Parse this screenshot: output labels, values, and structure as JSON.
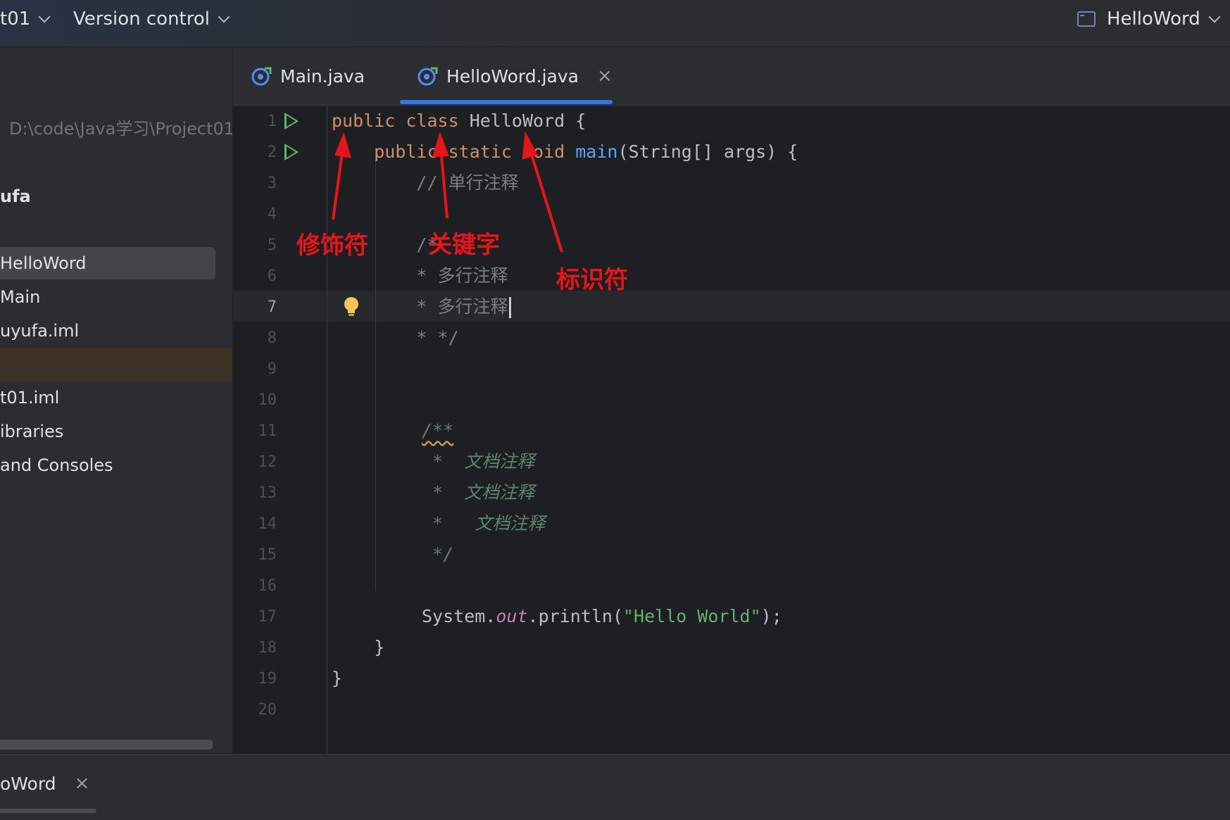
{
  "titlebar": {
    "project_label": "t01",
    "vcs_label": "Version control",
    "run_config": "HelloWord"
  },
  "sidebar": {
    "path": "D:\\code\\Java学习\\Project01",
    "module": "ufa",
    "items": [
      {
        "label": "HelloWord",
        "selected": true
      },
      {
        "label": "Main"
      },
      {
        "label": "uyufa.iml"
      },
      {
        "label": "",
        "active": true
      },
      {
        "label": "t01.iml"
      },
      {
        "label": "ibraries"
      },
      {
        "label": "and Consoles"
      }
    ]
  },
  "tabs": [
    {
      "label": "Main.java"
    },
    {
      "label": "HelloWord.java",
      "close": "×",
      "active": true
    }
  ],
  "editor": {
    "line_numbers": [
      "1",
      "2",
      "3",
      "4",
      "5",
      "6",
      "7",
      "8",
      "9",
      "10",
      "11",
      "12",
      "13",
      "14",
      "15",
      "16",
      "17",
      "18",
      "19",
      "20"
    ],
    "current_line": "7",
    "code": {
      "l1": {
        "a": "public",
        "b": " ",
        "c": "class",
        "d": " HelloWord {"
      },
      "l2": {
        "indent": "    ",
        "a": "public",
        "b": " ",
        "c": "static",
        "d": " ",
        "e": "void",
        "f": " ",
        "g": "main",
        "h": "(String[] args) {"
      },
      "l3": "        // 单行注释",
      "l5": "        /*",
      "l6": "        * 多行注释",
      "l7": "        * 多行注释",
      "l8": "        * */",
      "l11": "/**",
      "l12": " *  文档注释",
      "l13": " *  文档注释",
      "l14": " *   文档注释",
      "l15": " */",
      "l17": {
        "a": "System.",
        "b": "out",
        "c": ".println(",
        "d": "\"Hello World\"",
        "e": ");"
      },
      "l18": "    }",
      "l19": "}"
    }
  },
  "annotations": {
    "modifier": "修饰符",
    "keyword": "关键字",
    "identifier": "标识符"
  },
  "bottom": {
    "run_tab": "oWord",
    "close": "×"
  },
  "colors": {
    "keyword": "#cf8e6d",
    "function": "#56a8f5",
    "comment": "#7a7e85",
    "doc_comment": "#5f826b",
    "string": "#6aab73",
    "annotation": "#e8141b",
    "tab_accent": "#3574f0"
  }
}
